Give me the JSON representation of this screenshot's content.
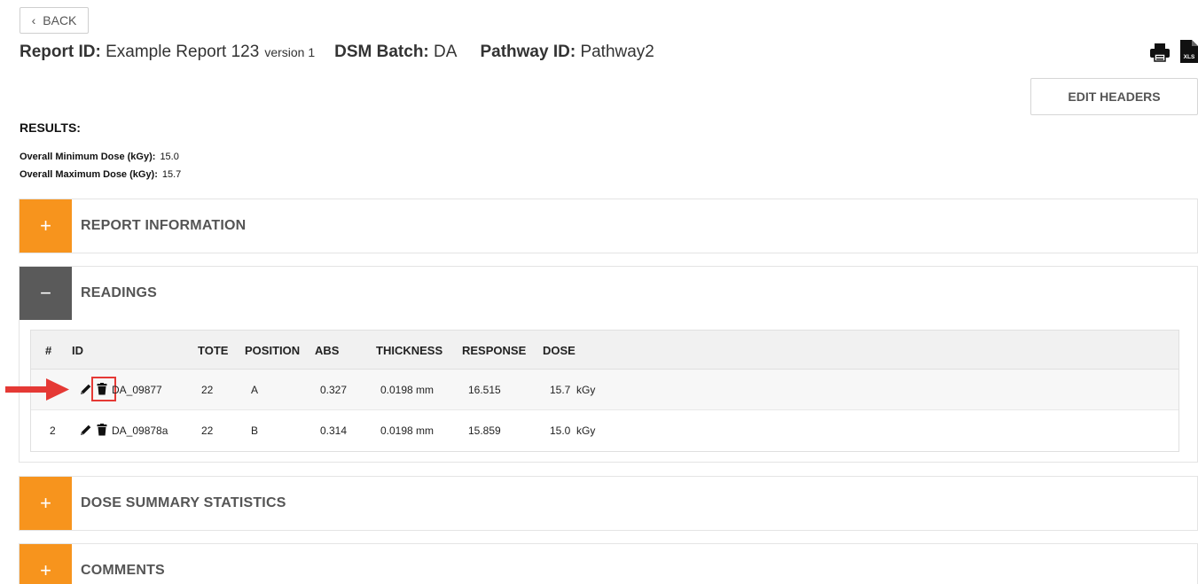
{
  "nav": {
    "back_label": "BACK"
  },
  "header": {
    "report_id_label": "Report ID:",
    "report_id_value": "Example Report 123",
    "version_text": "version 1",
    "dsm_batch_label": "DSM Batch:",
    "dsm_batch_value": "DA",
    "pathway_id_label": "Pathway ID:",
    "pathway_id_value": "Pathway2",
    "edit_headers_label": "EDIT HEADERS",
    "xls_icon_text": "XLS"
  },
  "results": {
    "title": "RESULTS:",
    "min_label": "Overall Minimum Dose (kGy):",
    "min_value": "15.0",
    "max_label": "Overall Maximum Dose (kGy):",
    "max_value": "15.7"
  },
  "sections": {
    "report_info": {
      "label": "REPORT INFORMATION",
      "toggle": "+"
    },
    "readings": {
      "label": "READINGS",
      "toggle": "−"
    },
    "dose_summary": {
      "label": "DOSE SUMMARY STATISTICS",
      "toggle": "+"
    },
    "comments": {
      "label": "COMMENTS",
      "toggle": "+"
    }
  },
  "readings_table": {
    "columns": [
      "#",
      "ID",
      "TOTE",
      "POSITION",
      "ABS",
      "THICKNESS",
      "RESPONSE",
      "DOSE"
    ],
    "rows": [
      {
        "num": "",
        "id": "DA_09877",
        "tote": "22",
        "position": "A",
        "abs": "0.327",
        "thickness": "0.0198 mm",
        "response": "16.515",
        "dose": "15.7  kGy"
      },
      {
        "num": "2",
        "id": "DA_09878a",
        "tote": "22",
        "position": "B",
        "abs": "0.314",
        "thickness": "0.0198 mm",
        "response": "15.859",
        "dose": "15.0  kGy"
      }
    ]
  },
  "colors": {
    "accent": "#f7941d",
    "collapsed_grey": "#5a5a5a",
    "highlight": "#e53935"
  }
}
